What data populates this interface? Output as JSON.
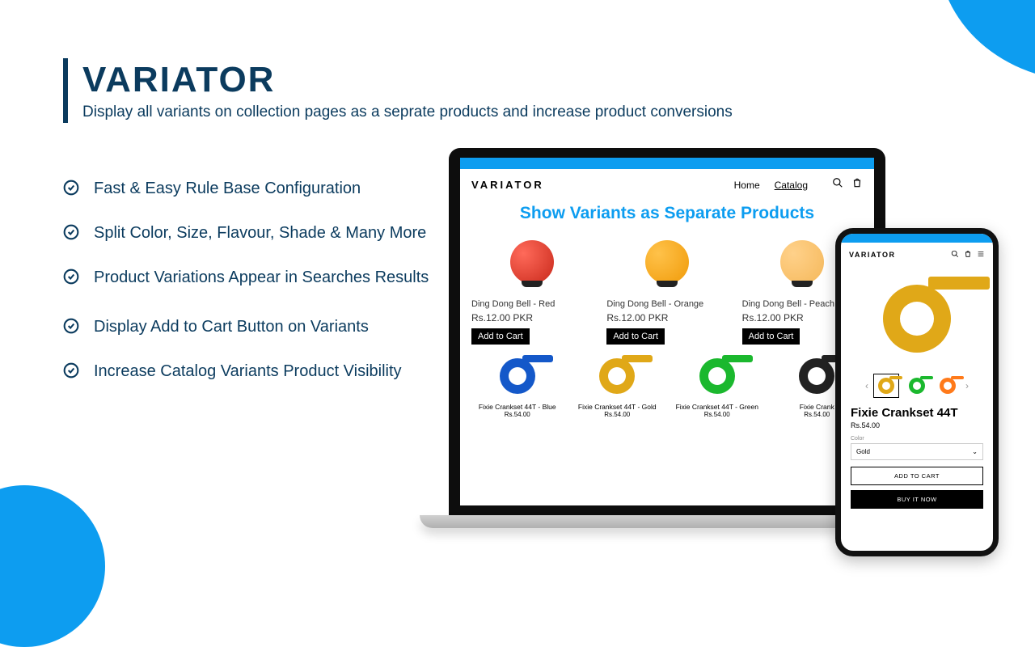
{
  "header": {
    "title": "VARIATOR",
    "subtitle": "Display all variants on collection pages as a seprate products and increase product conversions"
  },
  "features": [
    "Fast & Easy Rule Base Configuration",
    "Split Color, Size, Flavour, Shade & Many More",
    "Product Variations Appear in Searches Results",
    "Display Add to Cart Button on Variants",
    "Increase Catalog Variants Product Visibility"
  ],
  "laptop": {
    "logo": "VARIATOR",
    "nav": {
      "home": "Home",
      "catalog": "Catalog"
    },
    "heading": "Show Variants as Separate Products",
    "bells": [
      {
        "name": "Ding Dong Bell - Red",
        "price": "Rs.12.00 PKR",
        "btn": "Add to Cart"
      },
      {
        "name": "Ding Dong Bell - Orange",
        "price": "Rs.12.00 PKR",
        "btn": "Add to Cart"
      },
      {
        "name": "Ding Dong Bell - Peach",
        "price": "Rs.12.00 PKR",
        "btn": "Add to Cart"
      }
    ],
    "cranks": [
      {
        "name": "Fixie Crankset 44T - Blue",
        "price": "Rs.54.00"
      },
      {
        "name": "Fixie Crankset 44T - Gold",
        "price": "Rs.54.00"
      },
      {
        "name": "Fixie Crankset 44T - Green",
        "price": "Rs.54.00"
      },
      {
        "name": "Fixie Crank",
        "price": "Rs.54.00"
      }
    ]
  },
  "phone": {
    "logo": "VARIATOR",
    "title": "Fixie Crankset 44T",
    "price": "Rs.54.00",
    "color_label": "Color",
    "selected": "Gold",
    "add": "ADD TO CART",
    "buy": "BUY IT NOW"
  }
}
